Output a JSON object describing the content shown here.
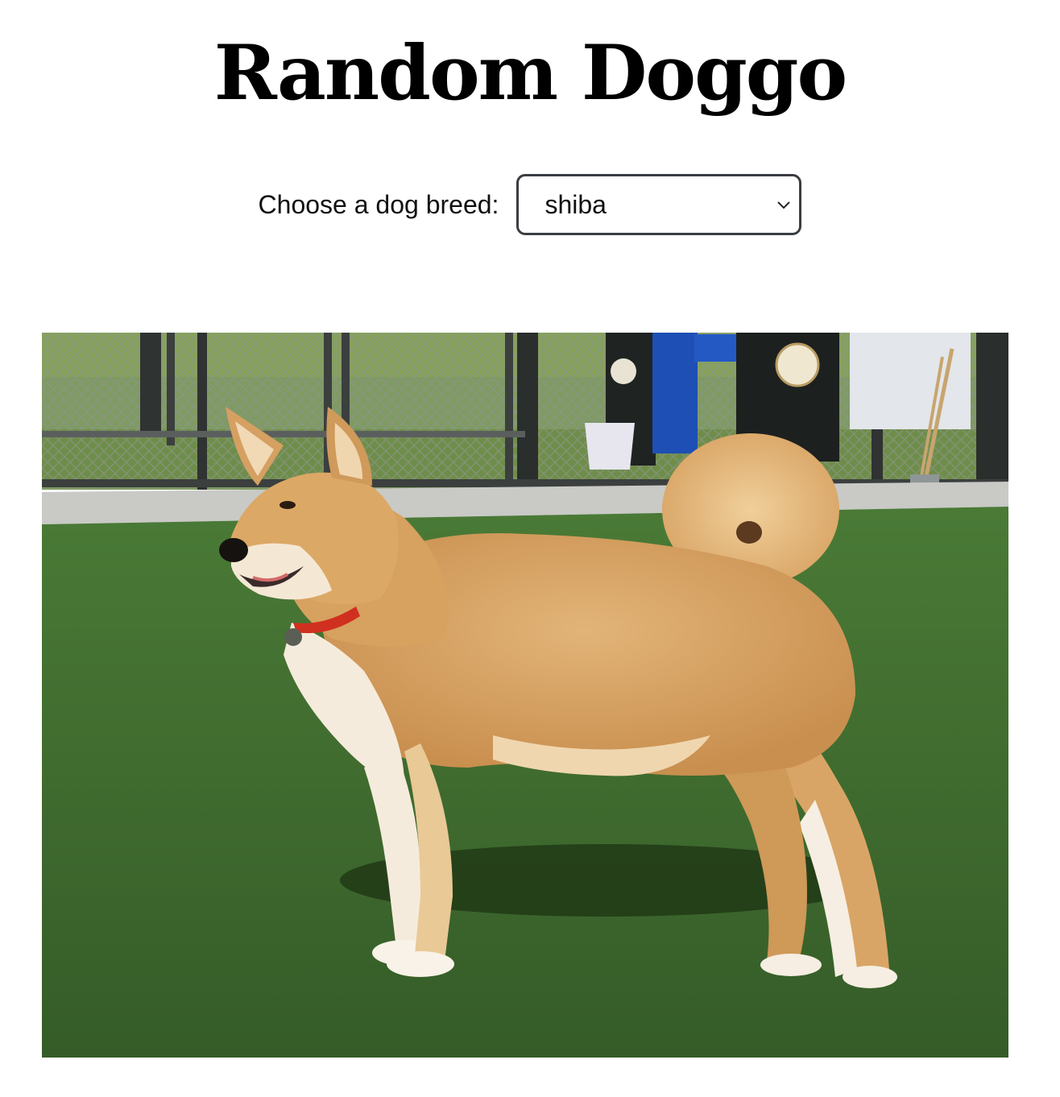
{
  "page": {
    "title": "Random Doggo"
  },
  "breed_picker": {
    "label": "Choose a dog breed:",
    "selected": "shiba",
    "chevron_icon": "chevron-down-icon"
  },
  "photo": {
    "icon": "shiba-inu-photo"
  },
  "colors": {
    "grass": "#3f6a2e",
    "fur": "#d9a566",
    "select_border": "#3a3d42"
  }
}
